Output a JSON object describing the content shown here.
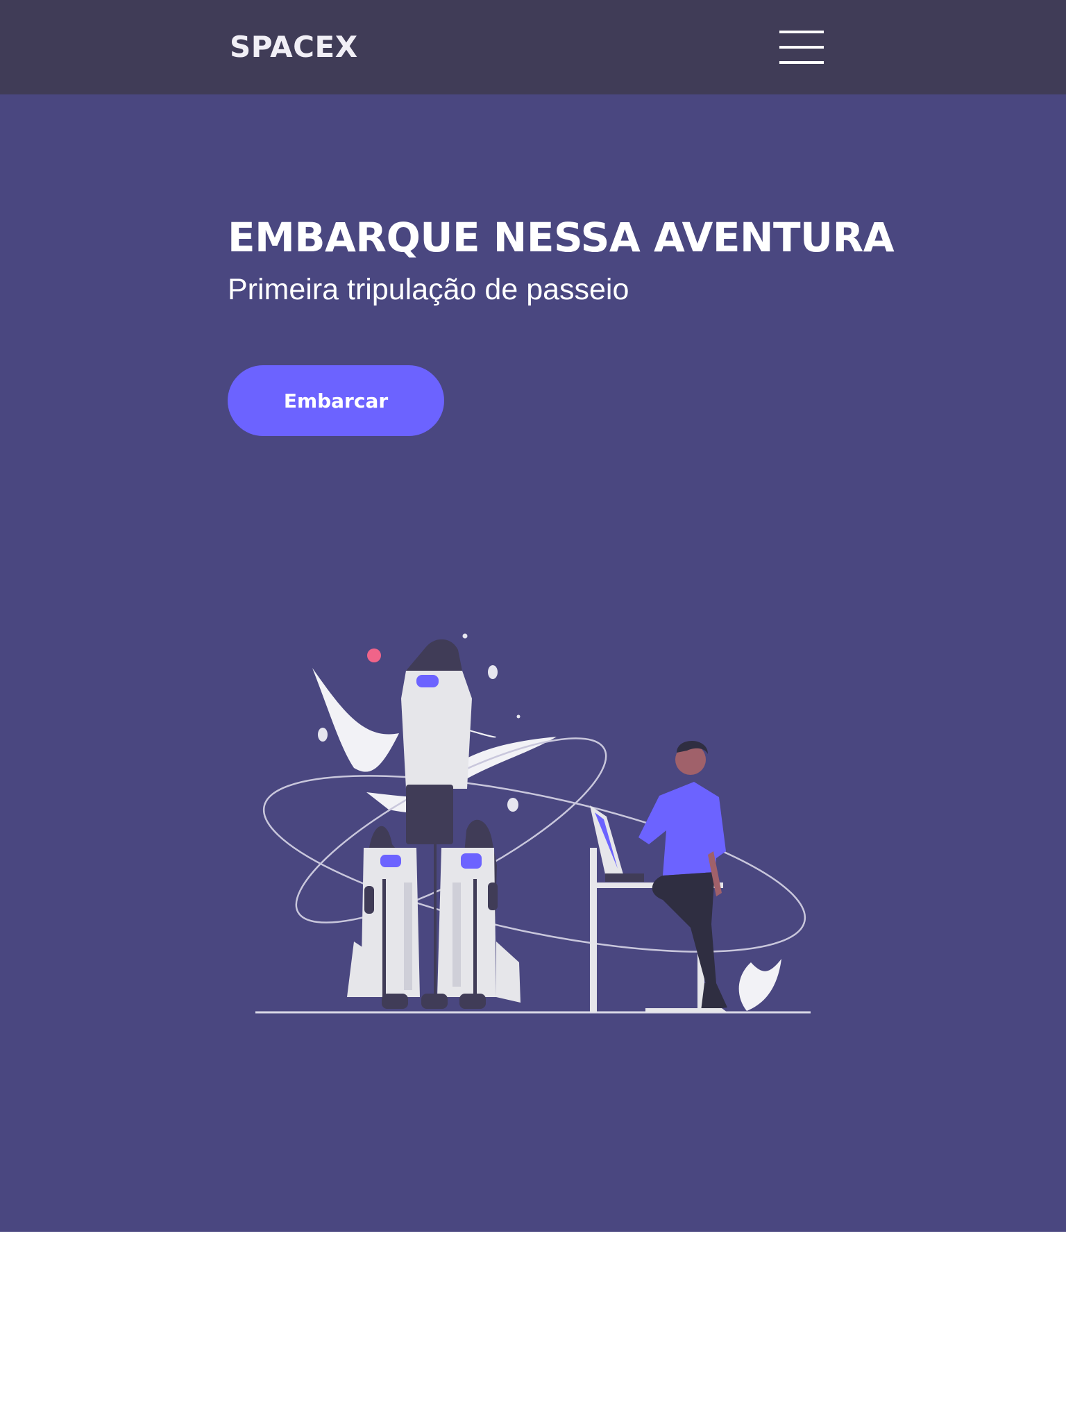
{
  "header": {
    "brand": "SPACEX",
    "menu_icon": "hamburger-menu-icon"
  },
  "hero": {
    "title": "EMBARQUE NESSA AVENTURA",
    "subtitle": "Primeira tripulação de passeio",
    "cta_label": "Embarcar",
    "illustration_icon": "rocket-launch-illustration"
  },
  "colors": {
    "header_bg": "#403c57",
    "hero_bg": "#4a4780",
    "accent": "#6c63ff",
    "text": "#ffffff"
  }
}
